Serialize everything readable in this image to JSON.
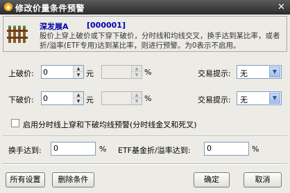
{
  "window": {
    "title": "修改价量条件预警",
    "close_glyph": "✕"
  },
  "stock": {
    "name": "深发展A",
    "code": "[000001]"
  },
  "description": "股价上穿上破价或下穿下破价，分时线和均线交叉，换手达到某比率，或者折/溢率(ETF专用)达到某比率，则进行预警。为0表示不启用。",
  "upper": {
    "label": "上破价:",
    "value": "0",
    "unit": "元",
    "pct_value": "",
    "pct_unit": "%",
    "hint_label": "交易提示:",
    "hint_value": "无"
  },
  "lower": {
    "label": "下破价:",
    "value": "0",
    "unit": "元",
    "pct_value": "",
    "pct_unit": "%",
    "hint_label": "交易提示:",
    "hint_value": "无"
  },
  "cross_option": {
    "label": "启用分时线上穿和下破均线预警(分时线金叉和死叉)",
    "checked": false
  },
  "turnover": {
    "label": "换手达到:",
    "value": "0",
    "unit": "%"
  },
  "etf": {
    "label": "ETF基金折/溢率达到:",
    "value": "0",
    "unit": "%"
  },
  "buttons": {
    "all_settings": "所有设置",
    "delete": "删除条件",
    "ok": "确定",
    "cancel": "取消"
  },
  "icons": {
    "title_logo": "app-logo-icon",
    "stock": "fence-icon",
    "spin_up": "▲",
    "spin_down": "▼",
    "dropdown": "▼"
  }
}
